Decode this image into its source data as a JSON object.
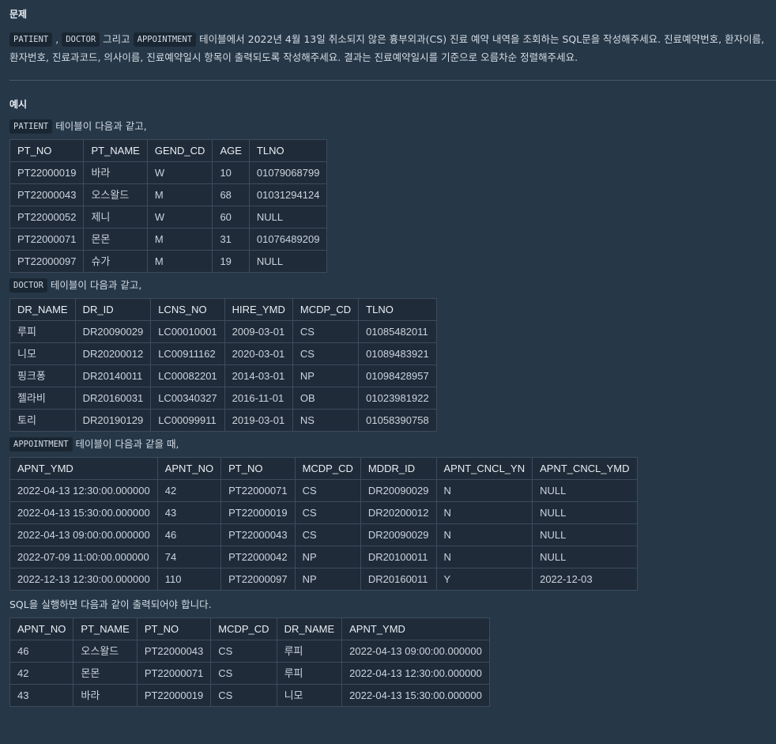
{
  "problem": {
    "title": "문제",
    "tag_patient": "PATIENT",
    "sep1": ",",
    "tag_doctor": "DOCTOR",
    "text_a": "그리고",
    "tag_appointment": "APPOINTMENT",
    "line1_rest": "테이블에서 2022년 4월 13일 취소되지 않은 흉부외과(CS) 진료 예약 내역을 조회하는 SQL문을 작성해주세요. 진료예약번호, 환자이름,",
    "line2": "환자번호, 진료과코드, 의사이름, 진료예약일시 항목이 출력되도록 작성해주세요. 결과는 진료예약일시를 기준으로 오름차순 정렬해주세요."
  },
  "example": {
    "title": "예시",
    "patient_intro_tag": "PATIENT",
    "patient_intro_text": "테이블이 다음과 같고,",
    "doctor_intro_tag": "DOCTOR",
    "doctor_intro_text": "테이블이 다음과 같고,",
    "appointment_intro_tag": "APPOINTMENT",
    "appointment_intro_text": "테이블이 다음과 같을 때,",
    "result_intro": "SQL을 실행하면 다음과 같이 출력되어야 합니다."
  },
  "patient_table": {
    "columns": [
      "PT_NO",
      "PT_NAME",
      "GEND_CD",
      "AGE",
      "TLNO"
    ],
    "rows": [
      [
        "PT22000019",
        "바라",
        "W",
        "10",
        "01079068799"
      ],
      [
        "PT22000043",
        "오스왈드",
        "M",
        "68",
        "01031294124"
      ],
      [
        "PT22000052",
        "제니",
        "W",
        "60",
        "NULL"
      ],
      [
        "PT22000071",
        "몬몬",
        "M",
        "31",
        "01076489209"
      ],
      [
        "PT22000097",
        "슈가",
        "M",
        "19",
        "NULL"
      ]
    ]
  },
  "doctor_table": {
    "columns": [
      "DR_NAME",
      "DR_ID",
      "LCNS_NO",
      "HIRE_YMD",
      "MCDP_CD",
      "TLNO"
    ],
    "rows": [
      [
        "루피",
        "DR20090029",
        "LC00010001",
        "2009-03-01",
        "CS",
        "01085482011"
      ],
      [
        "니모",
        "DR20200012",
        "LC00911162",
        "2020-03-01",
        "CS",
        "01089483921"
      ],
      [
        "핑크퐁",
        "DR20140011",
        "LC00082201",
        "2014-03-01",
        "NP",
        "01098428957"
      ],
      [
        "젤라비",
        "DR20160031",
        "LC00340327",
        "2016-11-01",
        "OB",
        "01023981922"
      ],
      [
        "토리",
        "DR20190129",
        "LC00099911",
        "2019-03-01",
        "NS",
        "01058390758"
      ]
    ]
  },
  "appointment_table": {
    "columns": [
      "APNT_YMD",
      "APNT_NO",
      "PT_NO",
      "MCDP_CD",
      "MDDR_ID",
      "APNT_CNCL_YN",
      "APNT_CNCL_YMD"
    ],
    "rows": [
      [
        "2022-04-13 12:30:00.000000",
        "42",
        "PT22000071",
        "CS",
        "DR20090029",
        "N",
        "NULL"
      ],
      [
        "2022-04-13 15:30:00.000000",
        "43",
        "PT22000019",
        "CS",
        "DR20200012",
        "N",
        "NULL"
      ],
      [
        "2022-04-13 09:00:00.000000",
        "46",
        "PT22000043",
        "CS",
        "DR20090029",
        "N",
        "NULL"
      ],
      [
        "2022-07-09 11:00:00.000000",
        "74",
        "PT22000042",
        "NP",
        "DR20100011",
        "N",
        "NULL"
      ],
      [
        "2022-12-13 12:30:00.000000",
        "110",
        "PT22000097",
        "NP",
        "DR20160011",
        "Y",
        "2022-12-03"
      ]
    ]
  },
  "result_table": {
    "columns": [
      "APNT_NO",
      "PT_NAME",
      "PT_NO",
      "MCDP_CD",
      "DR_NAME",
      "APNT_YMD"
    ],
    "rows": [
      [
        "46",
        "오스왈드",
        "PT22000043",
        "CS",
        "루피",
        "2022-04-13 09:00:00.000000"
      ],
      [
        "42",
        "몬몬",
        "PT22000071",
        "CS",
        "루피",
        "2022-04-13 12:30:00.000000"
      ],
      [
        "43",
        "바라",
        "PT22000019",
        "CS",
        "니모",
        "2022-04-13 15:30:00.000000"
      ]
    ]
  }
}
